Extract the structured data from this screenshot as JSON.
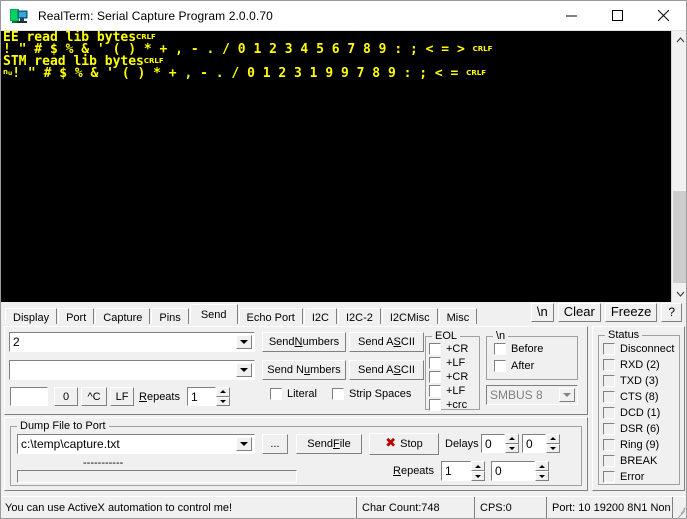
{
  "window": {
    "title": "RealTerm: Serial Capture Program 2.0.0.70",
    "icon": "terminal-monitor-icon",
    "minimize": "–",
    "maximize": "□",
    "close": "✕"
  },
  "terminal": {
    "fg_color": "#ffff00",
    "bg_color": "#000000",
    "lines": [
      {
        "text": "EE read lib bytes",
        "eol": "CRLF"
      },
      {
        "text": "! \" # $ % & ' ( ) * + , - . / 0 1 2 3 4 5 6 7 8 9 : ; < = > ",
        "eol": "CRLF"
      },
      {
        "text": "STM read lib bytes",
        "eol": "CRLF"
      },
      {
        "prefix": "ctrl",
        "text": "! \" # $ % & ' ( ) * + , - . / 0 1 2 3 1 9 9 7 8 9 : ; < = ",
        "eol": "CRLF"
      }
    ]
  },
  "tabs": {
    "items": [
      {
        "label": "Display",
        "active": false
      },
      {
        "label": "Port",
        "active": false
      },
      {
        "label": "Capture",
        "active": false
      },
      {
        "label": "Pins",
        "active": false
      },
      {
        "label": "Send",
        "active": true
      },
      {
        "label": "Echo Port",
        "active": false
      },
      {
        "label": "I2C",
        "active": false
      },
      {
        "label": "I2C-2",
        "active": false
      },
      {
        "label": "I2CMisc",
        "active": false
      },
      {
        "label": "Misc",
        "active": false
      }
    ],
    "toolbuttons": [
      {
        "label": "\\n",
        "name": "newline-button"
      },
      {
        "label": "Clear",
        "name": "clear-button"
      },
      {
        "label": "Freeze",
        "name": "freeze-button"
      },
      {
        "label": "?",
        "name": "help-button"
      }
    ]
  },
  "send": {
    "row1": {
      "combo_value": "2",
      "send_numbers": "Send Numbers",
      "send_ascii": "Send ASCII"
    },
    "row2": {
      "combo_value": "",
      "send_numbers": "Send Numbers",
      "send_ascii": "Send ASCII"
    },
    "small_textbox": "",
    "btn_zero": "0",
    "btn_ctrlc": "^C",
    "btn_lf": "LF",
    "repeats_label": "Repeats",
    "repeats_value": "1",
    "literal_label": "Literal",
    "strip_spaces_label": "Strip Spaces",
    "eol": {
      "group_label": "EOL",
      "items": [
        "+CR",
        "+LF",
        "+CR",
        "+LF",
        "+crc"
      ]
    },
    "newline_group": {
      "group_label": "\\n",
      "items": [
        "Before",
        "After"
      ]
    },
    "crc_combo_value": "SMBUS 8"
  },
  "dump": {
    "group_label": "Dump File to Port",
    "file_path": "c:\\temp\\capture.txt",
    "browse_label": "...",
    "send_file_label": "Send File",
    "stop_label": "Stop",
    "stop_icon": "red-x-icon",
    "delays_label": "Delays",
    "delay1": "0",
    "delay2": "0",
    "repeats_label": "Repeats",
    "repeats1": "1",
    "repeats2": "0",
    "progress_dots": "-----------",
    "progress_percent": 0
  },
  "status": {
    "group_label": "Status",
    "items": [
      "Disconnect",
      "RXD (2)",
      "TXD (3)",
      "CTS (8)",
      "DCD (1)",
      "DSR (6)",
      "Ring (9)",
      "BREAK",
      "Error"
    ]
  },
  "statusbar": {
    "message": "You can use ActiveX automation to control me!",
    "char_count": "Char Count:748",
    "cps": "CPS:0",
    "port": "Port: 10 19200 8N1 Non"
  }
}
